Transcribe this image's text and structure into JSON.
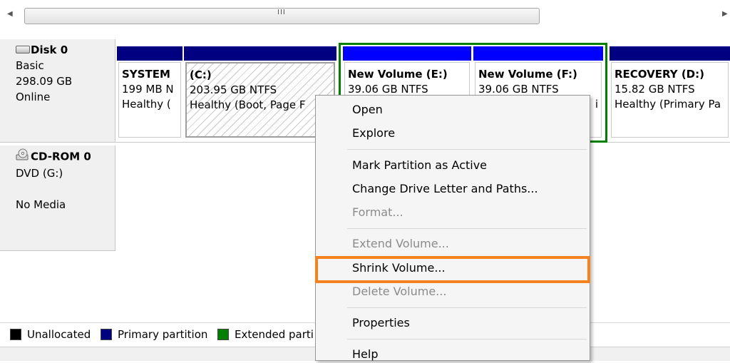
{
  "scrollbar": {
    "grip": "III",
    "left_arrow": "◀",
    "right_arrow": "▶"
  },
  "disks": [
    {
      "name": "Disk 0",
      "icon": "hard-disk-icon",
      "lines": [
        "Basic",
        "298.09 GB",
        "Online"
      ]
    },
    {
      "name": "CD-ROM 0",
      "icon": "cd-rom-icon",
      "lines": [
        "DVD (G:)",
        "",
        "No Media"
      ]
    }
  ],
  "partitions": [
    {
      "name": "SYSTEM",
      "size": "199 MB N",
      "status": "Healthy ("
    },
    {
      "name": "(C:)",
      "size": "203.95 GB NTFS",
      "status": "Healthy (Boot, Page F"
    },
    {
      "name": "New Volume  (E:)",
      "size": "39.06 GB NTFS",
      "status": ""
    },
    {
      "name": "New Volume  (F:)",
      "size": "39.06 GB NTFS",
      "status": "i"
    },
    {
      "name": "RECOVERY  (D:)",
      "size": "15.82 GB NTFS",
      "status": "Healthy (Primary Pa"
    }
  ],
  "legend": [
    {
      "label": "Unallocated",
      "color": "#000000"
    },
    {
      "label": "Primary partition",
      "color": "#000080"
    },
    {
      "label": "Extended parti",
      "color": "#008000"
    }
  ],
  "context_menu": {
    "items": [
      {
        "label": "Open",
        "enabled": true
      },
      {
        "label": "Explore",
        "enabled": true
      },
      {
        "label": "Mark Partition as Active",
        "enabled": true
      },
      {
        "label": "Change Drive Letter and Paths...",
        "enabled": true
      },
      {
        "label": "Format...",
        "enabled": false
      },
      {
        "label": "Extend Volume...",
        "enabled": false
      },
      {
        "label": "Shrink Volume...",
        "enabled": true,
        "highlighted": true
      },
      {
        "label": "Delete Volume...",
        "enabled": false
      },
      {
        "label": "Properties",
        "enabled": true
      },
      {
        "label": "Help",
        "enabled": true
      }
    ]
  },
  "colors": {
    "primary_partition": "#000080",
    "selected_partition": "#0000ff",
    "extended_partition": "#008000",
    "highlight": "#f58220"
  }
}
